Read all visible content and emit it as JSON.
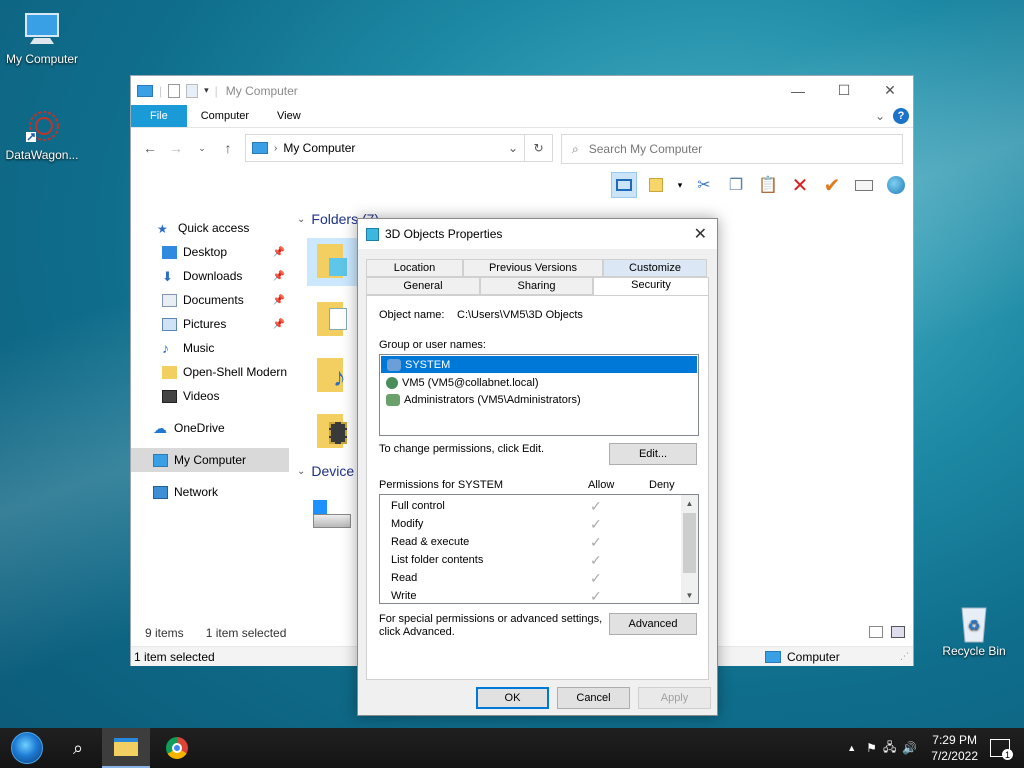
{
  "desktop": {
    "icons": [
      {
        "label": "My Computer"
      },
      {
        "label": "DataWagon..."
      },
      {
        "label": "Recycle Bin"
      }
    ]
  },
  "explorer": {
    "title": "My Computer",
    "ribbon_tabs": [
      "File",
      "Computer",
      "View"
    ],
    "address": "My Computer",
    "search_placeholder": "Search My Computer",
    "sidebar": {
      "quick_access": "Quick access",
      "items": [
        "Desktop",
        "Downloads",
        "Documents",
        "Pictures",
        "Music",
        "Open-Shell Modern",
        "Videos"
      ],
      "onedrive": "OneDrive",
      "my_computer": "My Computer",
      "network": "Network"
    },
    "folders_header": "Folders (7)",
    "devices_header": "Device",
    "status_items": "9 items",
    "status_selected": "1 item selected",
    "status_bottom_left": "1 item selected",
    "status_bottom_right": "Computer"
  },
  "dialog": {
    "title": "3D Objects Properties",
    "tabs_back": [
      "Location",
      "Previous Versions",
      "Customize"
    ],
    "tabs_front": [
      "General",
      "Sharing",
      "Security"
    ],
    "active_tab": "Security",
    "object_name_label": "Object name:",
    "object_name_value": "C:\\Users\\VM5\\3D Objects",
    "group_label": "Group or user names:",
    "users": [
      {
        "name": "SYSTEM",
        "selected": true
      },
      {
        "name": "VM5 (VM5@collabnet.local)",
        "selected": false
      },
      {
        "name": "Administrators (VM5\\Administrators)",
        "selected": false
      }
    ],
    "change_perm_text": "To change permissions, click Edit.",
    "edit_button": "Edit...",
    "perm_for_label": "Permissions for SYSTEM",
    "allow_header": "Allow",
    "deny_header": "Deny",
    "permissions": [
      {
        "name": "Full control",
        "allow": true
      },
      {
        "name": "Modify",
        "allow": true
      },
      {
        "name": "Read & execute",
        "allow": true
      },
      {
        "name": "List folder contents",
        "allow": true
      },
      {
        "name": "Read",
        "allow": true
      },
      {
        "name": "Write",
        "allow": true
      }
    ],
    "advanced_text_1": "For special permissions or advanced settings,",
    "advanced_text_2": "click Advanced.",
    "advanced_button": "Advanced",
    "ok_button": "OK",
    "cancel_button": "Cancel",
    "apply_button": "Apply"
  },
  "taskbar": {
    "time": "7:29 PM",
    "date": "7/2/2022",
    "notification_count": "1"
  },
  "colors": {
    "accent": "#0078d7",
    "file_tab": "#1a9bd7",
    "taskbar": "#1a1a1a"
  }
}
